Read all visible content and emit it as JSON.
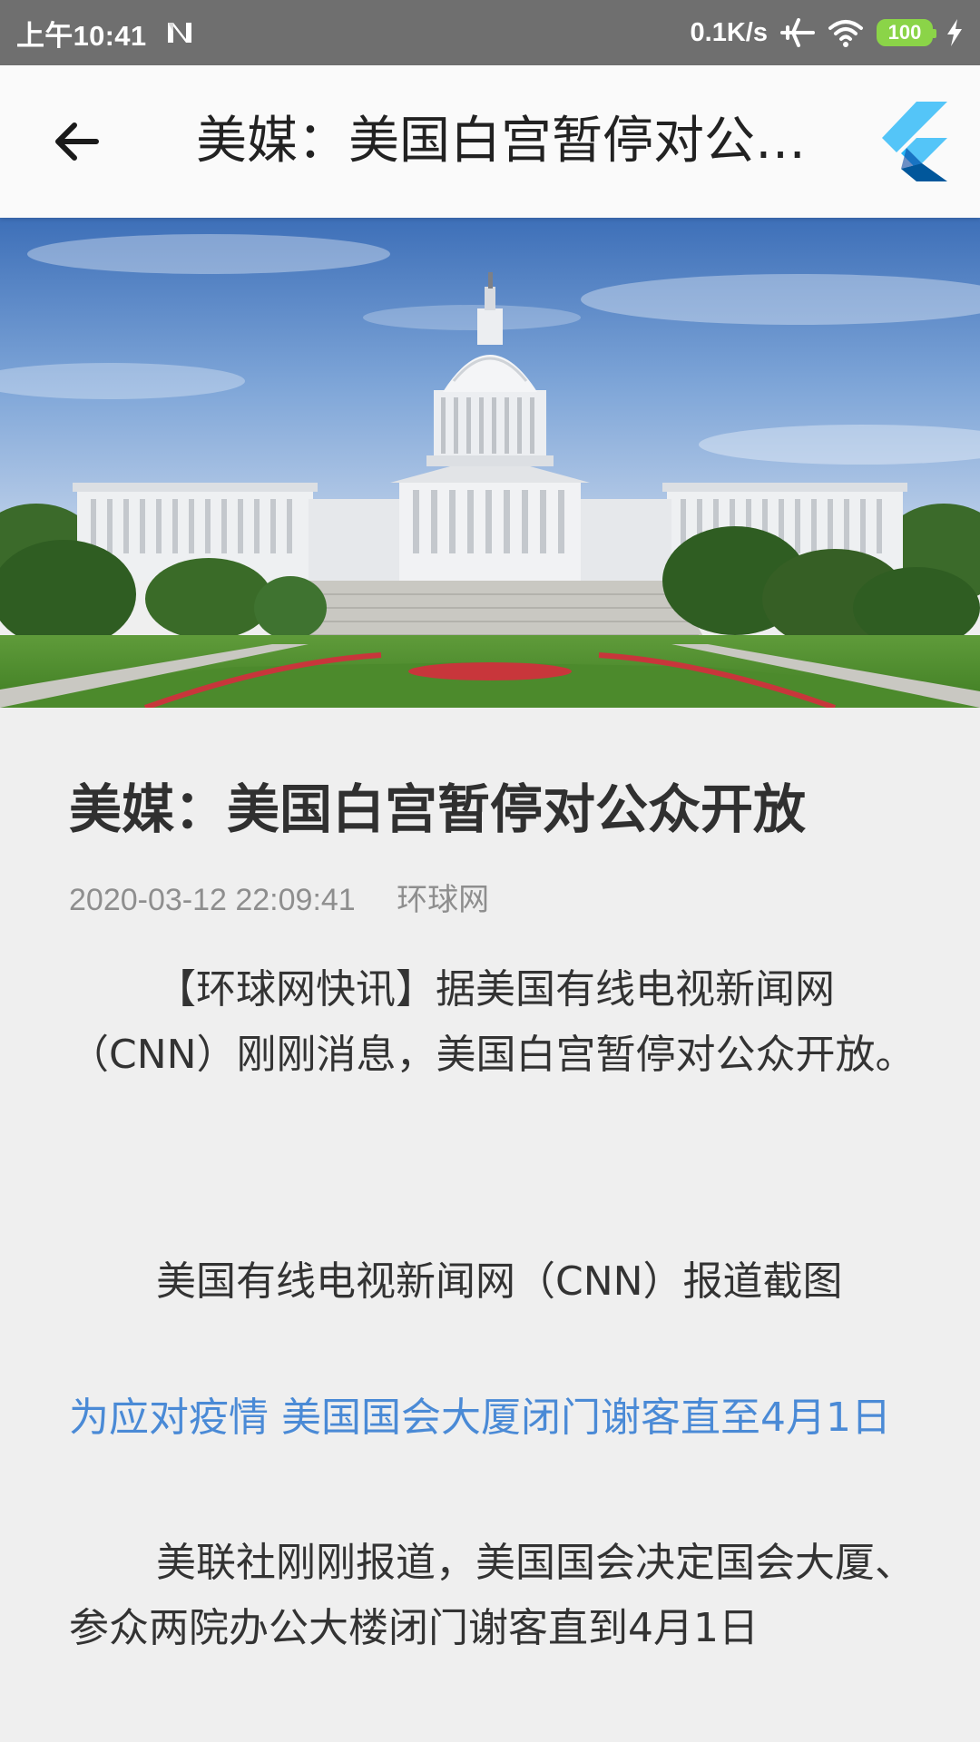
{
  "status_bar": {
    "time": "上午10:41",
    "net_speed": "0.1K/s",
    "battery": "100",
    "icons": [
      "n-icon",
      "airplane-icon",
      "wifi-icon",
      "battery-icon",
      "charging-icon"
    ]
  },
  "app_bar": {
    "title": "美媒：美国白宫暂停对公众开放",
    "back_icon": "arrow-back-icon",
    "logo_icon": "flutter-logo-icon"
  },
  "article": {
    "title": "美媒：美国白宫暂停对公众开放",
    "date": "2020-03-12 22:09:41",
    "source": "环球网",
    "paragraph_1": "【环球网快讯】据美国有线电视新闻网（CNN）刚刚消息，美国白宫暂停对公众开放。",
    "image_caption": "美国有线电视新闻网（CNN）报道截图",
    "related_link": "为应对疫情 美国国会大厦闭门谢客直至4月1日",
    "paragraph_2": "美联社刚刚报道，美国国会决定国会大厦、参众两院办公大楼闭门谢客直到4月1日"
  },
  "colors": {
    "status_bar": "#6f6f6f",
    "app_bar": "#fafafa",
    "background": "#efefef",
    "link": "#4a8ad6",
    "meta": "#8e8e8e",
    "battery": "#8bd448"
  }
}
